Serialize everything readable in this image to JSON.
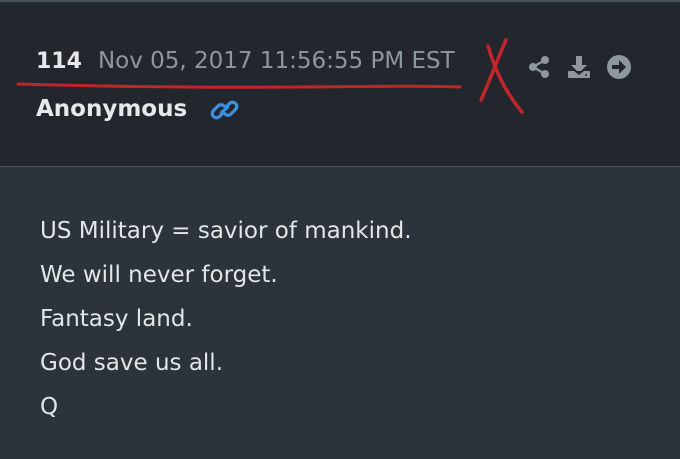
{
  "post": {
    "number": "114",
    "date": "Nov 05, 2017 11:56:55 PM EST",
    "author": "Anonymous",
    "lines": [
      "US Military = savior of mankind.",
      "We will never forget.",
      "Fantasy land.",
      "God save us all.",
      "Q"
    ]
  },
  "icons": {
    "link": "link-icon",
    "share": "share-icon",
    "download": "download-icon",
    "forward": "arrow-right-circle-icon"
  },
  "colors": {
    "background": "#262b32",
    "header": "#23272d",
    "text": "#e6e8ea",
    "muted": "#8f969e",
    "link_accent": "#3d8fe0",
    "annotation_red": "#c0262b"
  },
  "annotations": {
    "underline": "red hand-drawn underline under post number and date",
    "mark": "red hand-drawn X"
  }
}
